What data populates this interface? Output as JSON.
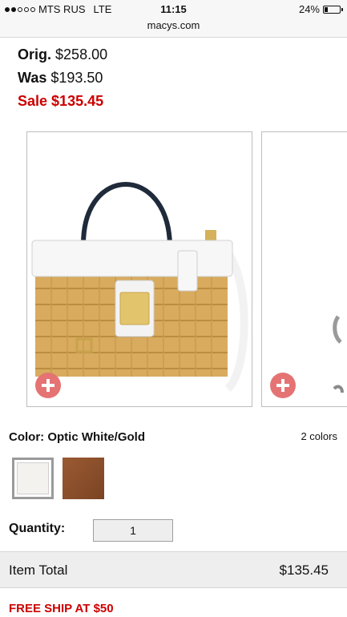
{
  "status_bar": {
    "carrier": "MTS RUS",
    "network": "LTE",
    "time": "11:15",
    "url": "macys.com",
    "battery": "24%",
    "battery_level": 0.24,
    "signal_dots_filled": 2,
    "signal_dots_total": 5
  },
  "prices": {
    "orig_label": "Orig.",
    "orig_value": "$258.00",
    "was_label": "Was",
    "was_value": "$193.50",
    "sale_label": "Sale",
    "sale_value": "$135.45"
  },
  "color": {
    "label": "Color: Optic White/Gold",
    "count": "2 colors",
    "swatches": [
      {
        "name": "Optic White/Gold",
        "hex": "#f4f2ee",
        "selected": true
      },
      {
        "name": "brown",
        "hex": "#8b4f2c",
        "selected": false
      }
    ]
  },
  "quantity": {
    "label": "Quantity:",
    "value": "1"
  },
  "total": {
    "label": "Item Total",
    "value": "$135.45"
  },
  "promo": {
    "text": "FREE SHIP AT $50"
  },
  "colors": {
    "sale_red": "#cc0000",
    "plus_button": "#e57373"
  },
  "icons": [
    "add-plus-icon"
  ]
}
